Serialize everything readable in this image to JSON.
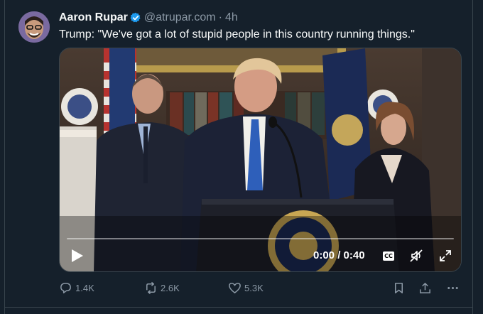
{
  "tweet": {
    "author_name": "Aaron Rupar",
    "handle": "@atrupar.com",
    "separator": "·",
    "time": "4h",
    "text": "Trump: \"We've got a lot of stupid people in this country running things.\""
  },
  "video": {
    "time_display": "0:00 / 0:40",
    "cc_label": "CC",
    "progress": 0
  },
  "actions": {
    "reply_count": "1.4K",
    "repost_count": "2.6K",
    "like_count": "5.3K"
  },
  "colors": {
    "background": "#15202b",
    "border": "#38444d",
    "secondary_text": "#8b98a5",
    "verified": "#1d9bf0"
  }
}
